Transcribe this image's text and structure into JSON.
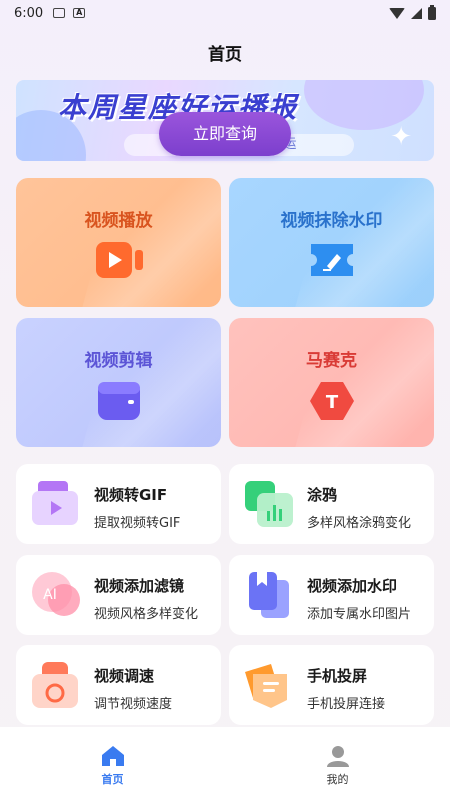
{
  "status_bar": {
    "time": "6:00",
    "icons": [
      "image-icon",
      "a-icon",
      "wifi-icon",
      "signal-icon",
      "battery-icon"
    ]
  },
  "header": {
    "title": "首页"
  },
  "banner": {
    "title": "本周星座好运播报",
    "subtitle": "分享好运 传递好运",
    "cta": "立即查询"
  },
  "big_cards": [
    {
      "label": "视频播放",
      "icon": "video-play-icon",
      "color": "#e0632b"
    },
    {
      "label": "视频抹除水印",
      "icon": "eraser-ticket-icon",
      "color": "#2f7bd8"
    },
    {
      "label": "视频剪辑",
      "icon": "wallet-icon",
      "color": "#6b63e0"
    },
    {
      "label": "马赛克",
      "icon": "mosaic-hexagon-icon",
      "color": "#e0403a"
    }
  ],
  "small_cards": [
    {
      "title": "视频转GIF",
      "subtitle": "提取视频转GIF",
      "icon": "video-gif-icon"
    },
    {
      "title": "涂鸦",
      "subtitle": "多样风格涂鸦变化",
      "icon": "graffiti-chart-icon"
    },
    {
      "title": "视频添加滤镜",
      "subtitle": "视频风格多样变化",
      "icon": "ai-filter-icon"
    },
    {
      "title": "视频添加水印",
      "subtitle": "添加专属水印图片",
      "icon": "bookmark-watermark-icon"
    },
    {
      "title": "视频调速",
      "subtitle": "调节视频速度",
      "icon": "speed-camera-icon"
    },
    {
      "title": "手机投屏",
      "subtitle": "手机投屏连接",
      "icon": "screen-cast-icon"
    }
  ],
  "tabbar": {
    "tabs": [
      {
        "label": "首页",
        "icon": "home-icon",
        "active": true
      },
      {
        "label": "我的",
        "icon": "profile-icon",
        "active": false
      }
    ],
    "active_color": "#3a7bf0"
  }
}
